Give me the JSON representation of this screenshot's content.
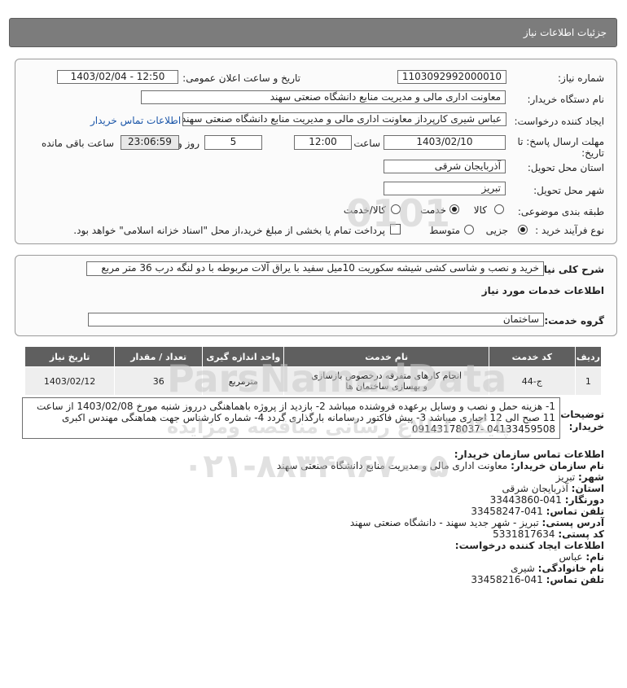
{
  "header": {
    "title": "جزئیات اطلاعات نیاز"
  },
  "form": {
    "need_number_label": "شماره نیاز:",
    "need_number": "1103092992000010",
    "announce_label": "تاریخ و ساعت اعلان عمومی:",
    "announce_value": "1403/02/04 - 12:50",
    "buyer_label": "نام دستگاه خریدار:",
    "buyer_value": "معاونت اداری  مالی و مدیریت منابع دانشگاه صنعتی سهند",
    "requester_label": "ایجاد کننده درخواست:",
    "requester_value": "عباس شیری کارپرداز معاونت اداری  مالی و مدیریت منابع دانشگاه صنعتی سهند",
    "buyer_contact_link": "اطلاعات تماس خریدار",
    "deadline_label_1": "مهلت ارسال پاسخ: تا",
    "deadline_label_2": "تاریخ:",
    "deadline_date": "1403/02/10",
    "time_label": "ساعت",
    "deadline_time": "12:00",
    "days_value": "5",
    "days_label": "روز و",
    "remaining_time": "23:06:59",
    "remaining_label": "ساعت باقی مانده",
    "province_label": "استان محل تحویل:",
    "province_value": "آذربایجان شرقی",
    "city_label": "شهر محل تحویل:",
    "city_value": "تبریز",
    "category_label": "طبقه بندی موضوعی:",
    "category_options": [
      "کالا",
      "خدمت",
      "کالا/خدمت"
    ],
    "category_selected": "خدمت",
    "process_label": "نوع فرآیند خرید :",
    "process_options": [
      "جزیی",
      "متوسط"
    ],
    "process_selected": "جزیی",
    "treasury_text": "پرداخت تمام یا بخشی از مبلغ خرید،از محل \"اسناد خزانه اسلامی\" خواهد بود."
  },
  "summary": {
    "label": "شرح کلی نیاز:",
    "value": "خرید و نصب و شاسی کشی شیشه سکوریت 10میل سفید با یراق آلات مربوطه با دو لنگه درب 36 متر مربع"
  },
  "services": {
    "section_title": "اطلاعات خدمات مورد نیاز",
    "group_label": "گروه خدمت:",
    "group_value": "ساختمان",
    "columns": [
      "ردیف",
      "کد خدمت",
      "نام خدمت",
      "واحد اندازه گیری",
      "تعداد / مقدار",
      "تاریخ نیاز"
    ],
    "rows": [
      {
        "row": "1",
        "code": "ج-44",
        "name": "انجام کارهای متفرقه درخصوص بازسازی و بهسازی ساختمان ها",
        "unit": "مترمربع",
        "quantity": "36",
        "date": "1403/02/12"
      }
    ]
  },
  "notes": {
    "label_1": "توضیحات",
    "label_2": "خریدار:",
    "text": "1- هزینه حمل و نصب و وسایل برعهده فروشنده میباشد 2- بازدید از پروژه باهماهنگی درروز شنبه مورخ 1403/02/08 از ساعت 11 صبح الی 12 اجباری میباشد 3- پیش فاکتور درسامانه بارگذاری گردد 4- شماره کارشناس جهت هماهنگی مهندس اکبری 04133459508 -09143178037"
  },
  "contact": {
    "title": "اطلاعات تماس سازمان خریدار:",
    "org_label": "نام سازمان خریدار:",
    "org_value": "معاونت اداری مالی و مدیریت منابع دانشگاه صنعتی سهند",
    "city_label": "شهر:",
    "city_value": "تبریز",
    "province_label": "استان:",
    "province_value": "آذربایجان شرقی",
    "fax_label": "دورنگار:",
    "fax_value": "041-33443860",
    "phone_label": "تلفن تماس:",
    "phone_value": "041-33458247",
    "address_label": "آدرس پستی:",
    "address_value": "تبریز - شهر جدید سهند - دانشگاه صنعتی سهند",
    "postal_label": "کد پستی:",
    "postal_value": "5331817634",
    "creator_title": "اطلاعات ایجاد کننده درخواست:",
    "name_label": "نام:",
    "name_value": "عباس",
    "family_label": "نام خانوادگی:",
    "family_value": "شیری",
    "creator_phone_label": "تلفن تماس:",
    "creator_phone_value": "041-33458216"
  },
  "watermark": {
    "brand": "ParsNamadData",
    "tagline": "پایگاه اطلاع رسانی مناقصه ومزایده",
    "phone": "۰۲۱-۸۸۳۴۹۶۷۰-۵",
    "digits": "0101"
  }
}
